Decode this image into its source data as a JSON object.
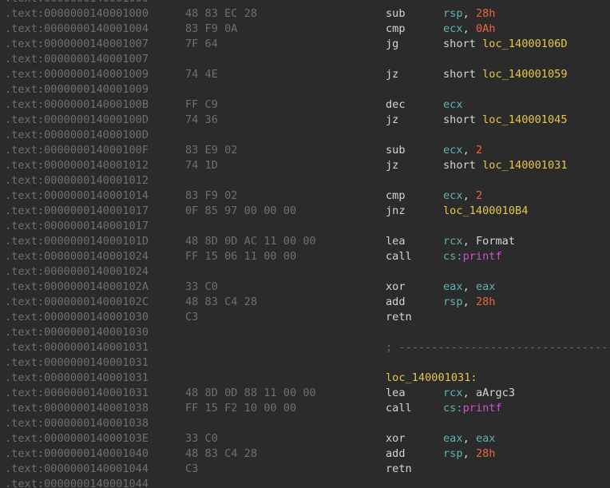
{
  "colors": {
    "background": "#2b2b2b",
    "address": "#6f6f6f",
    "bytes": "#6f6f6f",
    "mnemonic": "#d4d4d4",
    "register": "#5fb3b3",
    "number": "#f0643c",
    "label": "#e7c547",
    "function": "#d24dd3",
    "comment": "#6c6c6c"
  },
  "lines": [
    {
      "addr": ".text:0000000140001000",
      "bytes": "",
      "mnem": "",
      "ops": []
    },
    {
      "addr": ".text:0000000140001000",
      "bytes": "48 83 EC 28",
      "mnem": "sub",
      "ops": [
        {
          "t": "rsp",
          "c": "reg"
        },
        {
          "t": ", ",
          "c": "punct"
        },
        {
          "t": "28h",
          "c": "num"
        }
      ]
    },
    {
      "addr": ".text:0000000140001004",
      "bytes": "83 F9 0A",
      "mnem": "cmp",
      "ops": [
        {
          "t": "ecx",
          "c": "reg"
        },
        {
          "t": ", ",
          "c": "punct"
        },
        {
          "t": "0Ah",
          "c": "num"
        }
      ]
    },
    {
      "addr": ".text:0000000140001007",
      "bytes": "7F 64",
      "mnem": "jg",
      "ops": [
        {
          "t": "short ",
          "c": "kw"
        },
        {
          "t": "loc_14000106D",
          "c": "lbl"
        }
      ]
    },
    {
      "addr": ".text:0000000140001007",
      "bytes": "",
      "mnem": "",
      "ops": []
    },
    {
      "addr": ".text:0000000140001009",
      "bytes": "74 4E",
      "mnem": "jz",
      "ops": [
        {
          "t": "short ",
          "c": "kw"
        },
        {
          "t": "loc_140001059",
          "c": "lbl"
        }
      ]
    },
    {
      "addr": ".text:0000000140001009",
      "bytes": "",
      "mnem": "",
      "ops": []
    },
    {
      "addr": ".text:000000014000100B",
      "bytes": "FF C9",
      "mnem": "dec",
      "ops": [
        {
          "t": "ecx",
          "c": "reg"
        }
      ]
    },
    {
      "addr": ".text:000000014000100D",
      "bytes": "74 36",
      "mnem": "jz",
      "ops": [
        {
          "t": "short ",
          "c": "kw"
        },
        {
          "t": "loc_140001045",
          "c": "lbl"
        }
      ]
    },
    {
      "addr": ".text:000000014000100D",
      "bytes": "",
      "mnem": "",
      "ops": []
    },
    {
      "addr": ".text:000000014000100F",
      "bytes": "83 E9 02",
      "mnem": "sub",
      "ops": [
        {
          "t": "ecx",
          "c": "reg"
        },
        {
          "t": ", ",
          "c": "punct"
        },
        {
          "t": "2",
          "c": "num"
        }
      ]
    },
    {
      "addr": ".text:0000000140001012",
      "bytes": "74 1D",
      "mnem": "jz",
      "ops": [
        {
          "t": "short ",
          "c": "kw"
        },
        {
          "t": "loc_140001031",
          "c": "lbl"
        }
      ]
    },
    {
      "addr": ".text:0000000140001012",
      "bytes": "",
      "mnem": "",
      "ops": []
    },
    {
      "addr": ".text:0000000140001014",
      "bytes": "83 F9 02",
      "mnem": "cmp",
      "ops": [
        {
          "t": "ecx",
          "c": "reg"
        },
        {
          "t": ", ",
          "c": "punct"
        },
        {
          "t": "2",
          "c": "num"
        }
      ]
    },
    {
      "addr": ".text:0000000140001017",
      "bytes": "0F 85 97 00 00 00",
      "mnem": "jnz",
      "ops": [
        {
          "t": "loc_1400010B4",
          "c": "lbl"
        }
      ]
    },
    {
      "addr": ".text:0000000140001017",
      "bytes": "",
      "mnem": "",
      "ops": []
    },
    {
      "addr": ".text:000000014000101D",
      "bytes": "48 8D 0D AC 11 00 00",
      "mnem": "lea",
      "ops": [
        {
          "t": "rcx",
          "c": "reg"
        },
        {
          "t": ", ",
          "c": "punct"
        },
        {
          "t": "Format",
          "c": "sym"
        }
      ]
    },
    {
      "addr": ".text:0000000140001024",
      "bytes": "FF 15 06 11 00 00",
      "mnem": "call",
      "ops": [
        {
          "t": "cs:",
          "c": "seg"
        },
        {
          "t": "printf",
          "c": "func"
        }
      ]
    },
    {
      "addr": ".text:0000000140001024",
      "bytes": "",
      "mnem": "",
      "ops": []
    },
    {
      "addr": ".text:000000014000102A",
      "bytes": "33 C0",
      "mnem": "xor",
      "ops": [
        {
          "t": "eax",
          "c": "reg"
        },
        {
          "t": ", ",
          "c": "punct"
        },
        {
          "t": "eax",
          "c": "reg"
        }
      ]
    },
    {
      "addr": ".text:000000014000102C",
      "bytes": "48 83 C4 28",
      "mnem": "add",
      "ops": [
        {
          "t": "rsp",
          "c": "reg"
        },
        {
          "t": ", ",
          "c": "punct"
        },
        {
          "t": "28h",
          "c": "num"
        }
      ]
    },
    {
      "addr": ".text:0000000140001030",
      "bytes": "C3",
      "mnem": "retn",
      "ops": []
    },
    {
      "addr": ".text:0000000140001030",
      "bytes": "",
      "mnem": "",
      "ops": []
    },
    {
      "addr": ".text:0000000140001031",
      "bytes": "",
      "comment": "; ---------------------------------------------",
      "mnem": "",
      "ops": []
    },
    {
      "addr": ".text:0000000140001031",
      "bytes": "",
      "mnem": "",
      "ops": []
    },
    {
      "addr": ".text:0000000140001031",
      "bytes": "",
      "label": "loc_140001031:",
      "mnem": "",
      "ops": []
    },
    {
      "addr": ".text:0000000140001031",
      "bytes": "48 8D 0D 88 11 00 00",
      "mnem": "lea",
      "ops": [
        {
          "t": "rcx",
          "c": "reg"
        },
        {
          "t": ", ",
          "c": "punct"
        },
        {
          "t": "aArgc3",
          "c": "sym"
        }
      ]
    },
    {
      "addr": ".text:0000000140001038",
      "bytes": "FF 15 F2 10 00 00",
      "mnem": "call",
      "ops": [
        {
          "t": "cs:",
          "c": "seg"
        },
        {
          "t": "printf",
          "c": "func"
        }
      ]
    },
    {
      "addr": ".text:0000000140001038",
      "bytes": "",
      "mnem": "",
      "ops": []
    },
    {
      "addr": ".text:000000014000103E",
      "bytes": "33 C0",
      "mnem": "xor",
      "ops": [
        {
          "t": "eax",
          "c": "reg"
        },
        {
          "t": ", ",
          "c": "punct"
        },
        {
          "t": "eax",
          "c": "reg"
        }
      ]
    },
    {
      "addr": ".text:0000000140001040",
      "bytes": "48 83 C4 28",
      "mnem": "add",
      "ops": [
        {
          "t": "rsp",
          "c": "reg"
        },
        {
          "t": ", ",
          "c": "punct"
        },
        {
          "t": "28h",
          "c": "num"
        }
      ]
    },
    {
      "addr": ".text:0000000140001044",
      "bytes": "C3",
      "mnem": "retn",
      "ops": []
    },
    {
      "addr": ".text:0000000140001044",
      "bytes": "",
      "mnem": "",
      "ops": []
    }
  ]
}
